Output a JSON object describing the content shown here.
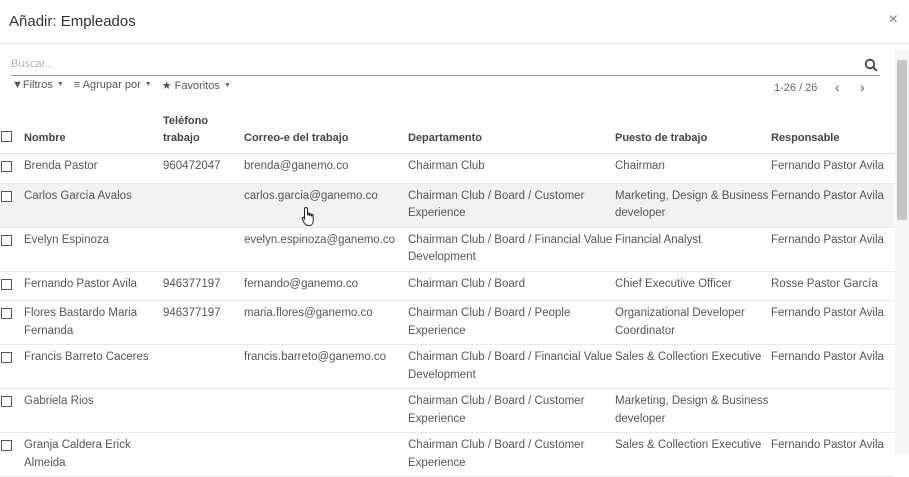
{
  "dialog": {
    "title": "Añadir: Empleados",
    "close_icon": "close-icon"
  },
  "search": {
    "placeholder": "Buscar...",
    "value": ""
  },
  "toolbar": {
    "filters": "Filtros",
    "group_by": "Agrupar por",
    "favorites": "Favoritos"
  },
  "pager": {
    "range": "1-26 / 26"
  },
  "table": {
    "headers": {
      "name": "Nombre",
      "phone_line1": "Teléfono",
      "phone_line2": "trabajo",
      "email": "Correo-e del trabajo",
      "department": "Departamento",
      "job": "Puesto de trabajo",
      "manager": "Responsable"
    },
    "rows": [
      {
        "name": "Brenda Pastor",
        "phone": "960472047",
        "email": "brenda@ganemo.co",
        "department": "Chairman Club",
        "job": "Chairman",
        "manager": "Fernando Pastor Avila"
      },
      {
        "name": "Carlos García Avalos",
        "phone": "",
        "email": "carlos.garcia@ganemo.co",
        "department": "Chairman Club / Board / Customer Experience",
        "job": "Marketing, Design & Business developer",
        "manager": "Fernando Pastor Avila"
      },
      {
        "name": "Evelyn Espinoza",
        "phone": "",
        "email": "evelyn.espinoza@ganemo.co",
        "department": "Chairman Club / Board / Financial Value Development",
        "job": "Financial Analyst",
        "manager": "Fernando Pastor Avila"
      },
      {
        "name": "Fernando Pastor Avila",
        "phone": "946377197",
        "email": "fernando@ganemo.co",
        "department": "Chairman Club / Board",
        "job": "Chief Executive Officer",
        "manager": "Rosse Pastor García"
      },
      {
        "name": "Flores Bastardo Maria Fernanda",
        "phone": "946377197",
        "email": "maria.flores@ganemo.co",
        "department": "Chairman Club / Board / People Experience",
        "job": "Organizational Developer Coordinator",
        "manager": "Fernando Pastor Avila"
      },
      {
        "name": "Francis Barreto Caceres",
        "phone": "",
        "email": "francis.barreto@ganemo.co",
        "department": "Chairman Club / Board / Financial Value Development",
        "job": "Sales & Collection Executive",
        "manager": "Fernando Pastor Avila"
      },
      {
        "name": "Gabriela Rios",
        "phone": "",
        "email": "",
        "department": "Chairman Club / Board / Customer Experience",
        "job": "Marketing, Design & Business developer",
        "manager": ""
      },
      {
        "name": "Granja Caldera Erick Almeida",
        "phone": "",
        "email": "",
        "department": "Chairman Club / Board / Customer Experience",
        "job": "Sales & Collection Executive",
        "manager": "Fernando Pastor Avila"
      }
    ]
  }
}
